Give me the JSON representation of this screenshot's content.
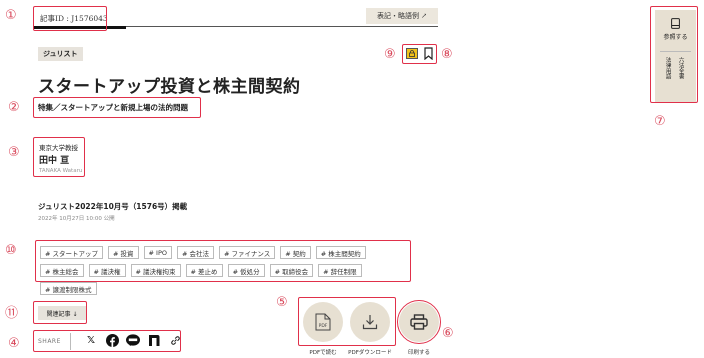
{
  "header": {
    "article_id": "記事ID : J1576043",
    "notation_button": "表記・略語例 ↗"
  },
  "category_tag": "ジュリスト",
  "icons": {
    "lock": "lock-icon",
    "bookmark": "bookmark-icon"
  },
  "article": {
    "title": "スタートアップ投資と株主間契約",
    "subtitle": "特集／スタートアップと新規上場の法的問題",
    "author_affiliation": "東京大学教授",
    "author_name": "田中 亘",
    "author_romaji": "TANAKA Wataru",
    "publication": "ジュリスト2022年10月号（1576号）掲載",
    "published_at": "2022年 10月27日 10:00 公開"
  },
  "tags": [
    "# スタートアップ",
    "# 投資",
    "# IPO",
    "# 会社法",
    "# ファイナンス",
    "# 契約",
    "# 株主間契約",
    "# 株主総会",
    "# 議決権",
    "# 議決権拘束",
    "# 差止め",
    "# 仮処分",
    "# 取締役会",
    "# 辞任制限",
    "# 譲渡制限株式"
  ],
  "related_button": "関連記事 ↓",
  "share": {
    "label": "SHARE",
    "icons": [
      "x-icon",
      "facebook-icon",
      "line-icon",
      "note-icon",
      "link-icon"
    ]
  },
  "actions": {
    "pdf_read": "PDFで読む",
    "pdf_download": "PDFダウンロード",
    "print": "印刷する",
    "pdf_badge": "PDF"
  },
  "side_panel": {
    "reference": "参照する",
    "col1": "六法全書",
    "col2": "法律用語"
  },
  "markers": [
    "①",
    "②",
    "③",
    "④",
    "⑤",
    "⑥",
    "⑦",
    "⑧",
    "⑨",
    "⑩",
    "⑪"
  ],
  "colors": {
    "accent_red": "#e0304a",
    "beige": "#e7e0d2",
    "lock_yellow": "#f2c21a"
  }
}
